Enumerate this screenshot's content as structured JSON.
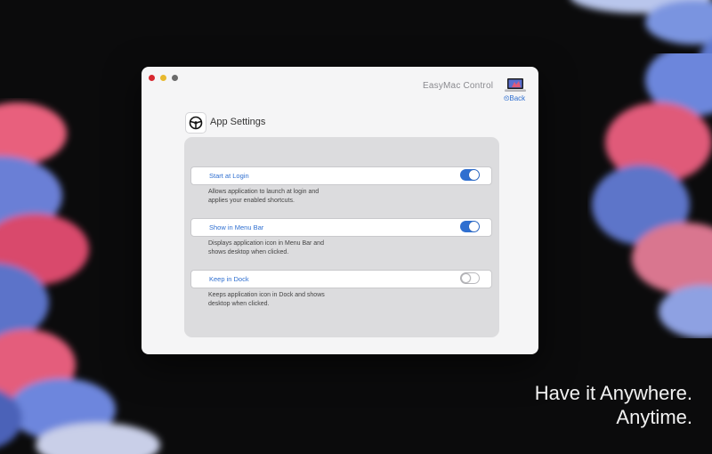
{
  "window": {
    "title": "EasyMac Control",
    "back_label": "⧀Back"
  },
  "settings": {
    "heading": "App Settings",
    "options": [
      {
        "label": "Start at Login",
        "enabled": true,
        "description_line1": "Allows application to launch at login and",
        "description_line2": "applies your enabled shortcuts."
      },
      {
        "label": "Show in Menu Bar",
        "enabled": true,
        "description_line1": "Displays application icon in Menu Bar and",
        "description_line2": "shows desktop when clicked."
      },
      {
        "label": "Keep in Dock",
        "enabled": false,
        "description_line1": "Keeps application icon in Dock and shows",
        "description_line2": "desktop when clicked."
      }
    ]
  },
  "tagline": {
    "line1": "Have it Anywhere.",
    "line2": "Anytime."
  },
  "colors": {
    "accent": "#2f6fd0",
    "background": "#0b0b0c",
    "window": "#f5f5f6",
    "panel": "#dcdcde"
  },
  "icons": [
    "close-dot-icon",
    "minimize-dot-icon",
    "maximize-dot-icon",
    "laptop-icon",
    "steering-wheel-icon"
  ]
}
